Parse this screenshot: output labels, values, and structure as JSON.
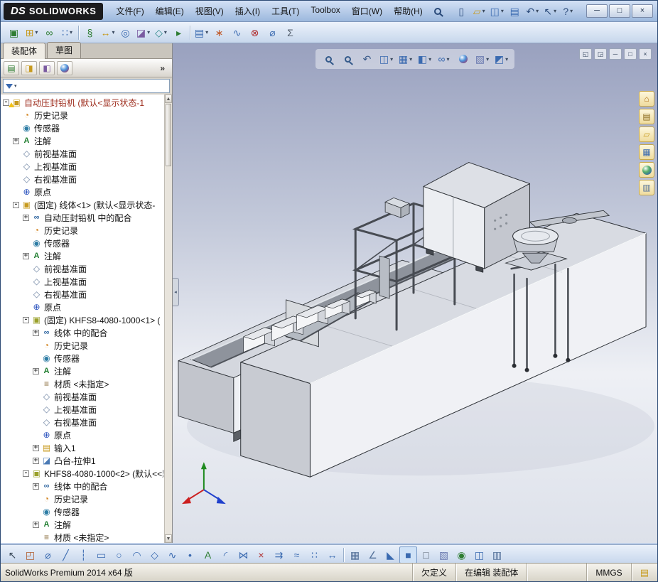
{
  "titlebar": {
    "brand_ds": "DS",
    "brand": "SOLIDWORKS",
    "menus": [
      {
        "name": "menu-file",
        "label": "文件(F)"
      },
      {
        "name": "menu-edit",
        "label": "编辑(E)"
      },
      {
        "name": "menu-view",
        "label": "视图(V)"
      },
      {
        "name": "menu-insert",
        "label": "插入(I)"
      },
      {
        "name": "menu-tools",
        "label": "工具(T)"
      },
      {
        "name": "menu-toolbox",
        "label": "Toolbox"
      },
      {
        "name": "menu-window",
        "label": "窗口(W)"
      },
      {
        "name": "menu-help",
        "label": "帮助(H)"
      }
    ],
    "quick": [
      {
        "name": "new-document-button",
        "glyph": "▯",
        "color": "#2a4a7a"
      },
      {
        "name": "open-button",
        "glyph": "▱",
        "color": "#c79a1e",
        "dd": true
      },
      {
        "name": "save-button",
        "glyph": "◫",
        "color": "#3a6ab0",
        "dd": true
      },
      {
        "name": "print-button",
        "glyph": "▤",
        "color": "#3a6ab0"
      },
      {
        "name": "undo-button",
        "glyph": "↶",
        "color": "#2a4a7a",
        "dd": true
      },
      {
        "name": "select-button",
        "glyph": "↖",
        "color": "#2a4a7a",
        "dd": true
      },
      {
        "name": "help-button",
        "glyph": "?",
        "color": "#2a4a7a",
        "dd": true
      }
    ],
    "window_buttons": [
      {
        "name": "minimize-button",
        "glyph": "─"
      },
      {
        "name": "maximize-button",
        "glyph": "□"
      },
      {
        "name": "close-button",
        "glyph": "×"
      }
    ]
  },
  "assembly_toolbar": [
    {
      "name": "edit-component-button",
      "glyph": "▣",
      "color": "#2e7d32"
    },
    {
      "name": "insert-components-button",
      "glyph": "⊞",
      "color": "#c79a1e",
      "dd": true
    },
    {
      "name": "mate-button",
      "glyph": "∞",
      "color": "#2e7d32"
    },
    {
      "name": "linear-component-pattern-button",
      "glyph": "∷",
      "color": "#3a6ab0",
      "dd": true
    },
    {
      "kind": "sep"
    },
    {
      "name": "smart-fasteners-button",
      "glyph": "§",
      "color": "#2e7d32"
    },
    {
      "name": "move-component-button",
      "glyph": "↔",
      "color": "#c79a1e",
      "dd": true
    },
    {
      "name": "show-hidden-components-button",
      "glyph": "◎",
      "color": "#3a6ab0"
    },
    {
      "name": "assembly-features-button",
      "glyph": "◪",
      "color": "#7a5aa0",
      "dd": true
    },
    {
      "name": "reference-geometry-button",
      "glyph": "◇",
      "color": "#2e8a8a",
      "dd": true
    },
    {
      "name": "new-motion-study-button",
      "glyph": "▸",
      "color": "#2e7d32"
    },
    {
      "kind": "sep"
    },
    {
      "name": "bill-of-materials-button",
      "glyph": "▤",
      "color": "#3a6ab0",
      "dd": true
    },
    {
      "name": "exploded-view-button",
      "glyph": "∗",
      "color": "#c05a2a"
    },
    {
      "name": "explode-line-sketch-button",
      "glyph": "∿",
      "color": "#3a6ab0"
    },
    {
      "name": "interference-detection-button",
      "glyph": "⊗",
      "color": "#b03030"
    },
    {
      "name": "measure-button",
      "glyph": "⌀",
      "color": "#3a6ab0"
    },
    {
      "name": "mass-properties-button",
      "glyph": "Σ",
      "color": "#55606e"
    }
  ],
  "panel": {
    "tabs": [
      {
        "name": "tab-assembly",
        "label": "装配体",
        "active": true
      },
      {
        "name": "tab-sketch",
        "label": "草图",
        "active": false
      }
    ],
    "manager_buttons": [
      {
        "name": "featuremanager-tab-button",
        "glyph": "▤",
        "color": "#2e7d32"
      },
      {
        "name": "propertymanager-tab-button",
        "glyph": "◨",
        "color": "#c79a1e"
      },
      {
        "name": "configurationmanager-tab-button",
        "glyph": "◧",
        "color": "#7a5aa0"
      },
      {
        "name": "displaymanager-tab-button",
        "kind": "ball",
        "glyph": "●"
      }
    ],
    "expand_label": "»"
  },
  "tree": [
    {
      "level": 0,
      "icon": "assembly-warn",
      "exp": "minus",
      "variant": "warn",
      "label": "自动压封铅机 (默认<显示状态-1"
    },
    {
      "level": 1,
      "icon": "history",
      "label": "历史记录"
    },
    {
      "level": 1,
      "icon": "sensors",
      "label": "传感器"
    },
    {
      "level": 1,
      "icon": "annotations",
      "exp": "plus",
      "label": "注解"
    },
    {
      "level": 1,
      "icon": "plane",
      "label": "前视基准面"
    },
    {
      "level": 1,
      "icon": "plane",
      "label": "上视基准面"
    },
    {
      "level": 1,
      "icon": "plane",
      "label": "右视基准面"
    },
    {
      "level": 1,
      "icon": "origin",
      "label": "原点"
    },
    {
      "level": 1,
      "icon": "assembly",
      "exp": "minus",
      "label": "(固定) 线体<1> (默认<显示状态-"
    },
    {
      "level": 2,
      "icon": "mates",
      "exp": "plus",
      "label": "自动压封铅机 中的配合"
    },
    {
      "level": 2,
      "icon": "history",
      "label": "历史记录"
    },
    {
      "level": 2,
      "icon": "sensors",
      "label": "传感器"
    },
    {
      "level": 2,
      "icon": "annotations",
      "exp": "plus",
      "label": "注解"
    },
    {
      "level": 2,
      "icon": "plane",
      "label": "前视基准面"
    },
    {
      "level": 2,
      "icon": "plane",
      "label": "上视基准面"
    },
    {
      "level": 2,
      "icon": "plane",
      "label": "右视基准面"
    },
    {
      "level": 2,
      "icon": "origin",
      "label": "原点"
    },
    {
      "level": 2,
      "icon": "part",
      "exp": "minus",
      "label": "(固定) KHFS8-4080-1000<1> ("
    },
    {
      "level": 3,
      "icon": "mates",
      "exp": "plus",
      "label": "线体 中的配合"
    },
    {
      "level": 3,
      "icon": "history",
      "label": "历史记录"
    },
    {
      "level": 3,
      "icon": "sensors",
      "label": "传感器"
    },
    {
      "level": 3,
      "icon": "annotations",
      "exp": "plus",
      "label": "注解"
    },
    {
      "level": 3,
      "icon": "material",
      "label": "材质 <未指定>"
    },
    {
      "level": 3,
      "icon": "plane",
      "label": "前视基准面"
    },
    {
      "level": 3,
      "icon": "plane",
      "label": "上视基准面"
    },
    {
      "level": 3,
      "icon": "plane",
      "label": "右视基准面"
    },
    {
      "level": 3,
      "icon": "origin",
      "label": "原点"
    },
    {
      "level": 3,
      "icon": "imported",
      "exp": "plus",
      "label": "输入1"
    },
    {
      "level": 3,
      "icon": "boss-extrude",
      "exp": "plus",
      "label": "凸台-拉伸1"
    },
    {
      "level": 2,
      "icon": "part",
      "exp": "minus",
      "label": "KHFS8-4080-1000<2> (默认<<默"
    },
    {
      "level": 3,
      "icon": "mates",
      "exp": "plus",
      "label": "线体 中的配合"
    },
    {
      "level": 3,
      "icon": "history",
      "label": "历史记录"
    },
    {
      "level": 3,
      "icon": "sensors",
      "label": "传感器"
    },
    {
      "level": 3,
      "icon": "annotations",
      "exp": "plus",
      "label": "注解"
    },
    {
      "level": 3,
      "icon": "material",
      "label": "材质 <未指定>"
    }
  ],
  "viewport": {
    "hud": [
      {
        "name": "zoom-to-fit-button",
        "kind": "mag"
      },
      {
        "name": "zoom-to-area-button",
        "kind": "mag"
      },
      {
        "name": "previous-view-button",
        "glyph": "↶",
        "color": "#3a5a8a"
      },
      {
        "name": "section-view-button",
        "glyph": "◫",
        "color": "#3a6ab0",
        "dd": true
      },
      {
        "name": "view-orientation-button",
        "glyph": "▦",
        "color": "#3a6ab0",
        "dd": true
      },
      {
        "name": "display-style-button",
        "glyph": "◧",
        "color": "#3a6ab0",
        "dd": true
      },
      {
        "name": "hide-show-items-button",
        "glyph": "∞",
        "color": "#3a6ab0",
        "dd": true
      },
      {
        "name": "edit-appearance-button",
        "kind": "ball",
        "glyph": "●"
      },
      {
        "name": "apply-scene-button",
        "glyph": "▧",
        "color": "#6a7ab0",
        "dd": true
      },
      {
        "name": "view-settings-button",
        "glyph": "◩",
        "color": "#3a6ab0",
        "dd": true
      }
    ],
    "doc_controls": [
      {
        "name": "viewport-prev-button",
        "glyph": "◱"
      },
      {
        "name": "viewport-next-button",
        "glyph": "◲"
      },
      {
        "name": "doc-minimize-button",
        "glyph": "─"
      },
      {
        "name": "doc-restore-button",
        "glyph": "□"
      },
      {
        "name": "doc-close-button",
        "glyph": "×"
      }
    ],
    "triad_colors": {
      "x": "#cc2020",
      "y": "#1e8a1e",
      "z": "#2040cc"
    }
  },
  "task_pane": [
    {
      "name": "solidworks-resources-button",
      "glyph": "⌂",
      "color": "#b0701a"
    },
    {
      "name": "design-library-button",
      "glyph": "▤",
      "color": "#8a6a20"
    },
    {
      "name": "file-explorer-button",
      "glyph": "▱",
      "color": "#c79a1e"
    },
    {
      "name": "view-palette-button",
      "glyph": "▦",
      "color": "#3a6ab0"
    },
    {
      "name": "appearances-scenes-button",
      "kind": "ball",
      "glyph": "●"
    },
    {
      "name": "custom-properties-button",
      "glyph": "▥",
      "color": "#55729a"
    }
  ],
  "sketch_toolbar": [
    {
      "name": "select-button",
      "glyph": "↖",
      "color": "#3a4a5a"
    },
    {
      "name": "sketch-button",
      "glyph": "◰",
      "color": "#b05a2a"
    },
    {
      "name": "smart-dimension-button",
      "glyph": "⌀",
      "color": "#3a6ab0"
    },
    {
      "name": "line-button",
      "glyph": "╱",
      "color": "#3a6ab0"
    },
    {
      "name": "centerline-button",
      "glyph": "┆",
      "color": "#3a6ab0"
    },
    {
      "name": "rectangle-button",
      "glyph": "▭",
      "color": "#3a6ab0"
    },
    {
      "name": "circle-button",
      "glyph": "○",
      "color": "#3a6ab0"
    },
    {
      "name": "arc-button",
      "glyph": "◠",
      "color": "#3a6ab0"
    },
    {
      "name": "polygon-button",
      "glyph": "◇",
      "color": "#3a6ab0"
    },
    {
      "name": "spline-button",
      "glyph": "∿",
      "color": "#3a6ab0"
    },
    {
      "name": "point-button",
      "glyph": "•",
      "color": "#3a6ab0"
    },
    {
      "name": "text-button",
      "glyph": "A",
      "color": "#2e7d32"
    },
    {
      "name": "sketch-fillet-button",
      "glyph": "◜",
      "color": "#3a6ab0"
    },
    {
      "name": "mirror-entities-button",
      "glyph": "⋈",
      "color": "#3a6ab0"
    },
    {
      "name": "trim-entities-button",
      "glyph": "×",
      "color": "#b03030"
    },
    {
      "name": "convert-entities-button",
      "glyph": "⇉",
      "color": "#3a6ab0"
    },
    {
      "name": "offset-entities-button",
      "glyph": "≈",
      "color": "#3a6ab0"
    },
    {
      "name": "linear-sketch-pattern-button",
      "glyph": "∷",
      "color": "#3a6ab0"
    },
    {
      "name": "move-entities-button",
      "glyph": "↔",
      "color": "#3a6ab0"
    },
    {
      "kind": "sep"
    },
    {
      "name": "display-grid-button",
      "glyph": "▦",
      "color": "#55729a"
    },
    {
      "name": "snap-angle-button",
      "glyph": "∠",
      "color": "#55729a"
    },
    {
      "name": "section-view-button",
      "glyph": "◣",
      "color": "#3a6ab0"
    },
    {
      "name": "shaded-with-edges-button",
      "glyph": "■",
      "color": "#3a6ab0",
      "active": true
    },
    {
      "name": "hidden-lines-button",
      "glyph": "□",
      "color": "#55606e"
    },
    {
      "name": "apply-scene-button",
      "glyph": "▧",
      "color": "#6a7ab0"
    },
    {
      "name": "camera-views-button",
      "glyph": "◉",
      "color": "#2e7d32"
    },
    {
      "name": "viewport-layout-button",
      "glyph": "◫",
      "color": "#3a6ab0"
    },
    {
      "name": "design-table-button",
      "glyph": "▥",
      "color": "#55729a"
    }
  ],
  "status": {
    "product": "SolidWorks Premium 2014 x64 版",
    "state": "欠定义",
    "editing": "在编辑 装配体",
    "units": "MMGS"
  }
}
